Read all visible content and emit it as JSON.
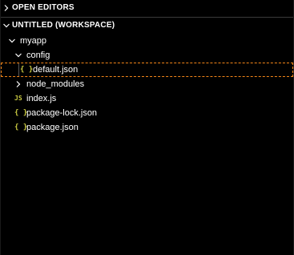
{
  "sections": {
    "open_editors": {
      "label": "OPEN EDITORS",
      "expanded": false
    },
    "workspace": {
      "label": "UNTITLED (WORKSPACE)",
      "expanded": true
    }
  },
  "tree": {
    "myapp": {
      "label": "myapp",
      "expanded": true
    },
    "config": {
      "label": "config",
      "expanded": true
    },
    "default_json": {
      "label": "default.json",
      "icon": "{ }",
      "selected": true
    },
    "node_modules": {
      "label": "node_modules",
      "expanded": false
    },
    "index_js": {
      "label": "index.js",
      "icon": "JS"
    },
    "package_lock_json": {
      "label": "package-lock.json",
      "icon": "{ }"
    },
    "package_json": {
      "label": "package.json",
      "icon": "{ }"
    }
  },
  "colors": {
    "background": "#000000",
    "text": "#ffffff",
    "json_icon": "#cbcb41",
    "js_icon": "#cbcb41",
    "focus_outline": "#f38518"
  }
}
